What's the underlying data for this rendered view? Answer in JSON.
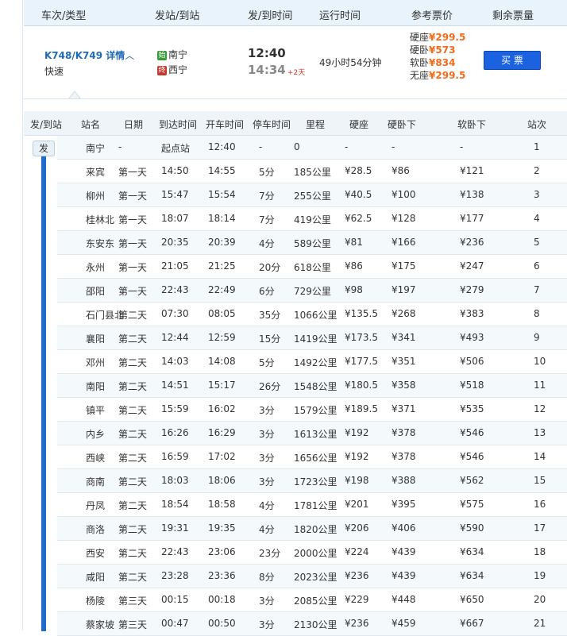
{
  "header": {
    "col_train": "车次/类型",
    "col_station": "发站/到站",
    "col_time": "发/到时间",
    "col_duration": "运行时间",
    "col_price": "参考票价",
    "col_remaining": "剩余票量"
  },
  "summary": {
    "train_code": "K748/K749",
    "details_label": "详情",
    "chevron": "︿",
    "train_type": "快速",
    "from_badge": "始",
    "from_station": "南宁",
    "to_badge": "终",
    "to_station": "西宁",
    "depart_time": "12:40",
    "arrive_time": "14:34",
    "plus_days": "+2天",
    "duration": "49小时54分钟",
    "prices": [
      {
        "label": "硬座",
        "value": "¥299.5"
      },
      {
        "label": "硬卧",
        "value": "¥573"
      },
      {
        "label": "软卧",
        "value": "¥834"
      },
      {
        "label": "无座",
        "value": "¥299.5"
      }
    ],
    "buy_label": "买 票"
  },
  "table": {
    "headers": {
      "dir": "发/到站",
      "station": "站名",
      "date": "日期",
      "arrive": "到达时间",
      "depart": "开车时间",
      "stop": "停车时间",
      "distance": "里程",
      "hard_seat": "硬座",
      "hard_sleeper": "硬卧下",
      "soft_sleeper": "软卧下",
      "seq": "站次"
    },
    "fa_tag": "发",
    "rows": [
      {
        "station": "南宁",
        "date": "-",
        "arrive": "起点站",
        "depart": "12:40",
        "stop": "-",
        "distance": "0",
        "hard_seat": "-",
        "hard_sleeper": "-",
        "soft_sleeper": "-",
        "seq": "1"
      },
      {
        "station": "来宾",
        "date": "第一天",
        "arrive": "14:50",
        "depart": "14:55",
        "stop": "5分",
        "distance": "185公里",
        "hard_seat": "¥28.5",
        "hard_sleeper": "¥86",
        "soft_sleeper": "¥121",
        "seq": "2"
      },
      {
        "station": "柳州",
        "date": "第一天",
        "arrive": "15:47",
        "depart": "15:54",
        "stop": "7分",
        "distance": "255公里",
        "hard_seat": "¥40.5",
        "hard_sleeper": "¥100",
        "soft_sleeper": "¥138",
        "seq": "3"
      },
      {
        "station": "桂林北",
        "date": "第一天",
        "arrive": "18:07",
        "depart": "18:14",
        "stop": "7分",
        "distance": "419公里",
        "hard_seat": "¥62.5",
        "hard_sleeper": "¥128",
        "soft_sleeper": "¥177",
        "seq": "4"
      },
      {
        "station": "东安东",
        "date": "第一天",
        "arrive": "20:35",
        "depart": "20:39",
        "stop": "4分",
        "distance": "589公里",
        "hard_seat": "¥81",
        "hard_sleeper": "¥166",
        "soft_sleeper": "¥236",
        "seq": "5"
      },
      {
        "station": "永州",
        "date": "第一天",
        "arrive": "21:05",
        "depart": "21:25",
        "stop": "20分",
        "distance": "618公里",
        "hard_seat": "¥86",
        "hard_sleeper": "¥175",
        "soft_sleeper": "¥247",
        "seq": "6"
      },
      {
        "station": "邵阳",
        "date": "第一天",
        "arrive": "22:43",
        "depart": "22:49",
        "stop": "6分",
        "distance": "729公里",
        "hard_seat": "¥98",
        "hard_sleeper": "¥197",
        "soft_sleeper": "¥279",
        "seq": "7"
      },
      {
        "station": "石门县北",
        "date": "第二天",
        "arrive": "07:30",
        "depart": "08:05",
        "stop": "35分",
        "distance": "1066公里",
        "hard_seat": "¥135.5",
        "hard_sleeper": "¥268",
        "soft_sleeper": "¥383",
        "seq": "8"
      },
      {
        "station": "襄阳",
        "date": "第二天",
        "arrive": "12:44",
        "depart": "12:59",
        "stop": "15分",
        "distance": "1419公里",
        "hard_seat": "¥173.5",
        "hard_sleeper": "¥341",
        "soft_sleeper": "¥493",
        "seq": "9"
      },
      {
        "station": "邓州",
        "date": "第二天",
        "arrive": "14:03",
        "depart": "14:08",
        "stop": "5分",
        "distance": "1492公里",
        "hard_seat": "¥177.5",
        "hard_sleeper": "¥351",
        "soft_sleeper": "¥506",
        "seq": "10"
      },
      {
        "station": "南阳",
        "date": "第二天",
        "arrive": "14:51",
        "depart": "15:17",
        "stop": "26分",
        "distance": "1548公里",
        "hard_seat": "¥180.5",
        "hard_sleeper": "¥358",
        "soft_sleeper": "¥518",
        "seq": "11"
      },
      {
        "station": "镇平",
        "date": "第二天",
        "arrive": "15:59",
        "depart": "16:02",
        "stop": "3分",
        "distance": "1579公里",
        "hard_seat": "¥189.5",
        "hard_sleeper": "¥371",
        "soft_sleeper": "¥535",
        "seq": "12"
      },
      {
        "station": "内乡",
        "date": "第二天",
        "arrive": "16:26",
        "depart": "16:29",
        "stop": "3分",
        "distance": "1613公里",
        "hard_seat": "¥192",
        "hard_sleeper": "¥378",
        "soft_sleeper": "¥546",
        "seq": "13"
      },
      {
        "station": "西峡",
        "date": "第二天",
        "arrive": "16:59",
        "depart": "17:02",
        "stop": "3分",
        "distance": "1656公里",
        "hard_seat": "¥192",
        "hard_sleeper": "¥378",
        "soft_sleeper": "¥546",
        "seq": "14"
      },
      {
        "station": "商南",
        "date": "第二天",
        "arrive": "18:03",
        "depart": "18:06",
        "stop": "3分",
        "distance": "1723公里",
        "hard_seat": "¥198",
        "hard_sleeper": "¥388",
        "soft_sleeper": "¥562",
        "seq": "15"
      },
      {
        "station": "丹凤",
        "date": "第二天",
        "arrive": "18:54",
        "depart": "18:58",
        "stop": "4分",
        "distance": "1781公里",
        "hard_seat": "¥201",
        "hard_sleeper": "¥395",
        "soft_sleeper": "¥575",
        "seq": "16"
      },
      {
        "station": "商洛",
        "date": "第二天",
        "arrive": "19:31",
        "depart": "19:35",
        "stop": "4分",
        "distance": "1820公里",
        "hard_seat": "¥206",
        "hard_sleeper": "¥406",
        "soft_sleeper": "¥590",
        "seq": "17"
      },
      {
        "station": "西安",
        "date": "第二天",
        "arrive": "22:43",
        "depart": "23:06",
        "stop": "23分",
        "distance": "2000公里",
        "hard_seat": "¥224",
        "hard_sleeper": "¥439",
        "soft_sleeper": "¥634",
        "seq": "18"
      },
      {
        "station": "咸阳",
        "date": "第二天",
        "arrive": "23:28",
        "depart": "23:36",
        "stop": "8分",
        "distance": "2023公里",
        "hard_seat": "¥236",
        "hard_sleeper": "¥439",
        "soft_sleeper": "¥634",
        "seq": "19"
      },
      {
        "station": "杨陵",
        "date": "第三天",
        "arrive": "00:15",
        "depart": "00:18",
        "stop": "3分",
        "distance": "2085公里",
        "hard_seat": "¥229",
        "hard_sleeper": "¥448",
        "soft_sleeper": "¥650",
        "seq": "20"
      },
      {
        "station": "蔡家坡",
        "date": "第三天",
        "arrive": "00:47",
        "depart": "00:50",
        "stop": "3分",
        "distance": "2130公里",
        "hard_seat": "¥236",
        "hard_sleeper": "¥459",
        "soft_sleeper": "¥667",
        "seq": "21"
      }
    ]
  },
  "colors": {
    "accent": "#1f6bb5",
    "route_line": "#1f6bcc",
    "price": "#f26b1c",
    "buy_button": "#1a62e0",
    "start_badge": "#3a9a3a",
    "end_badge": "#c8372d"
  }
}
